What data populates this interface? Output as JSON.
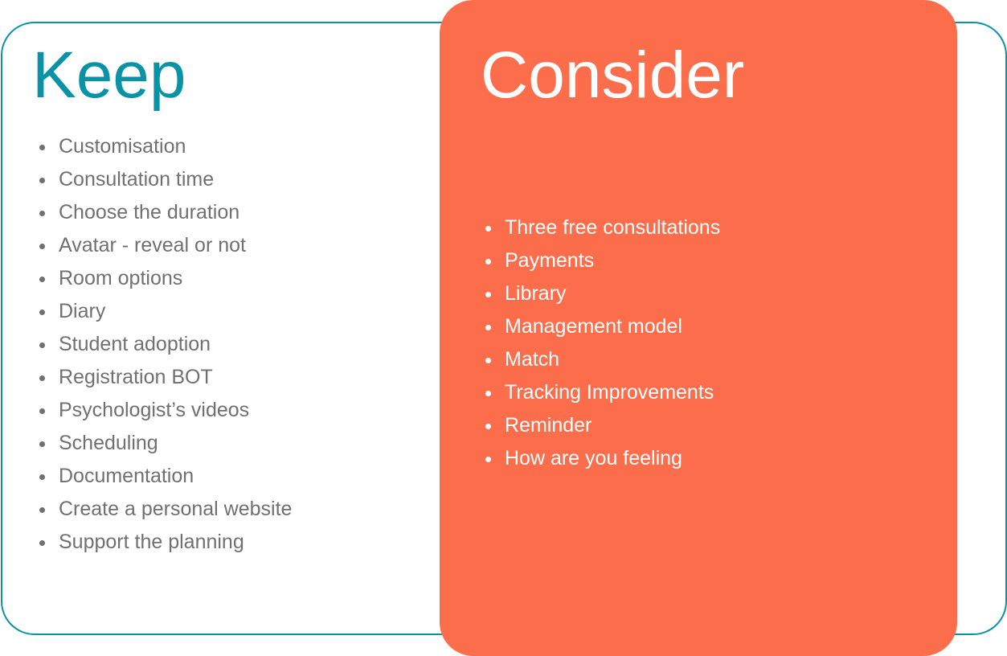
{
  "keep": {
    "title": "Keep",
    "items": [
      "Customisation",
      "Consultation time",
      "Choose the duration",
      "Avatar - reveal or not",
      "Room options",
      "Diary",
      "Student adoption",
      "Registration BOT",
      "Psychologist’s videos",
      "Scheduling",
      "Documentation",
      "Create a personal website",
      "Support the planning"
    ]
  },
  "consider": {
    "title": "Consider",
    "items": [
      "Three free consultations",
      "Payments",
      "Library",
      "Management model",
      "Match",
      "Tracking Improvements",
      "Reminder",
      "How are you feeling"
    ]
  },
  "colors": {
    "teal": "#0A93A6",
    "orange": "#FC6D4C",
    "text_gray": "#707070"
  }
}
